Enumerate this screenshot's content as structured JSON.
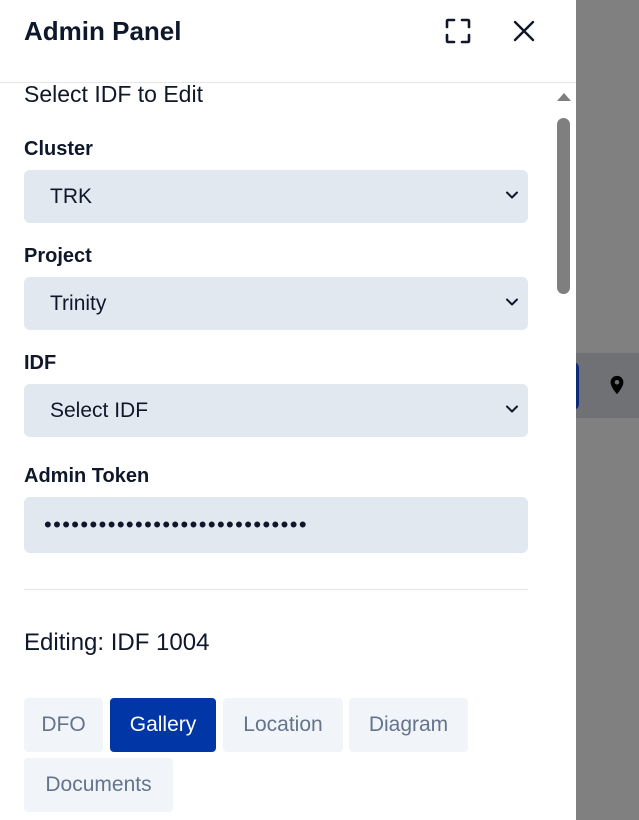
{
  "panel": {
    "title": "Admin Panel",
    "fullscreen_icon": "fullscreen-icon",
    "close_icon": "close-icon"
  },
  "select_section": {
    "title": "Select IDF to Edit",
    "cluster": {
      "label": "Cluster",
      "value": "TRK"
    },
    "project": {
      "label": "Project",
      "value": "Trinity"
    },
    "idf": {
      "label": "IDF",
      "value": "Select IDF"
    },
    "token": {
      "label": "Admin Token",
      "masked_value": "•••••••••••••••••••••••••••••"
    }
  },
  "editing": {
    "title": "Editing: IDF 1004",
    "tabs": [
      {
        "label": "DFO",
        "active": false
      },
      {
        "label": "Gallery",
        "active": true
      },
      {
        "label": "Location",
        "active": false
      },
      {
        "label": "Diagram",
        "active": false
      },
      {
        "label": "Documents",
        "active": false
      }
    ]
  },
  "background": {
    "pin_icon": "map-pin-icon"
  },
  "colors": {
    "accent": "#0036a6",
    "input_bg": "#e2e8f0",
    "tab_bg": "#f1f5f9",
    "tab_text": "#64748b",
    "overlay": "#808080"
  }
}
